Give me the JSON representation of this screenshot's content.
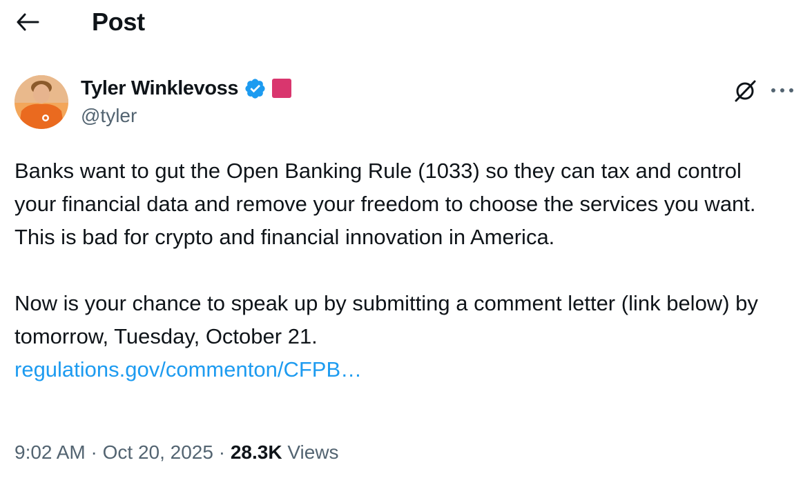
{
  "header": {
    "title": "Post",
    "back_icon": "arrow-left-icon"
  },
  "author": {
    "name": "Tyler Winklevoss",
    "handle": "@tyler",
    "verified_color": "#1d9bf0",
    "affiliate_badge_color": "#d9366e",
    "avatar_bg": "#e8772e"
  },
  "actions": {
    "grok_icon": "grok-icon",
    "more_icon": "more-horizontal-icon"
  },
  "post": {
    "paragraph_1": "Banks want to gut the Open Banking Rule (1033) so they can tax and control your financial data and remove your freedom to choose the services you want. This is bad for crypto and financial innovation in America.",
    "paragraph_2": "Now is your chance to speak up by submitting a comment letter (link below) by tomorrow, Tuesday, October 21.",
    "link_text": "regulations.gov/commenton/CFPB…",
    "link_color": "#1d9bf0"
  },
  "meta": {
    "time": "9:02 AM",
    "separator": " · ",
    "date": "Oct 20, 2025",
    "views_count": "28.3K",
    "views_label": " Views"
  }
}
